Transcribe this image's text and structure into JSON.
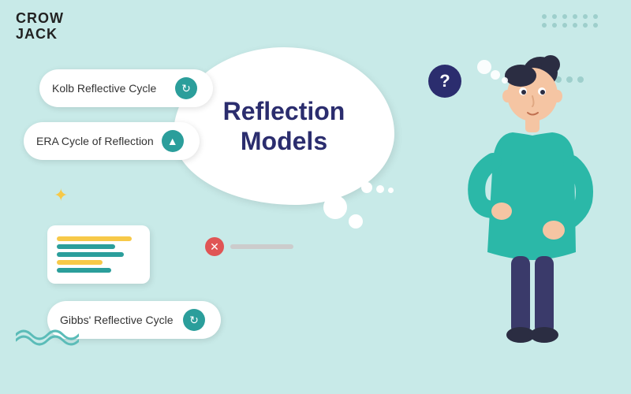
{
  "logo": {
    "line1": "CROW",
    "line2": "JACK"
  },
  "bubble": {
    "title_line1": "Reflection",
    "title_line2": "Models"
  },
  "pills": [
    {
      "id": "kolb",
      "label": "Kolb Reflective Cycle",
      "icon": "↻",
      "icon_type": "refresh"
    },
    {
      "id": "era",
      "label": "ERA Cycle of Reflection",
      "icon": "▲",
      "icon_type": "triangle"
    },
    {
      "id": "gibbs",
      "label": "Gibbs' Reflective Cycle",
      "icon": "↻",
      "icon_type": "refresh"
    }
  ],
  "colors": {
    "bg": "#c8eae8",
    "dark_navy": "#2b2d6e",
    "teal": "#2b9e9b",
    "white": "#ffffff",
    "yellow": "#f7c948",
    "red": "#e05555"
  },
  "decorations": {
    "sparkle": "✦",
    "question_mark": "?",
    "cross": "✕"
  }
}
